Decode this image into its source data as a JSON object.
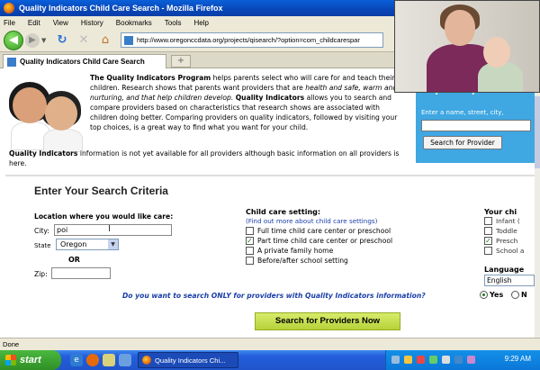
{
  "window": {
    "title": "Quality Indicators Child Care Search - Mozilla Firefox"
  },
  "menu": [
    "File",
    "Edit",
    "View",
    "History",
    "Bookmarks",
    "Tools",
    "Help"
  ],
  "nav": {
    "url": "http://www.oregonccdata.org/projects/qisearch/?option=com_childcarespar"
  },
  "tabs": [
    {
      "label": "Quality Indicators Child Care Search"
    }
  ],
  "page": {
    "intro_program": "The Quality Indicators Program",
    "intro_1": " helps parents select who will care for and teach their children. Research shows that parents want providers that are ",
    "intro_italic": "health and safe, warm and nurturing, and that help children develop.",
    "intro_qi": "Quality Indicators",
    "intro_2": " allows you to search and compare providers based on characteristics that research shows are associated with children doing better. Comparing providers on quality indicators, followed by visiting your top choices, is a great way to find what you want for your child.",
    "note_bold": "Quality Indicators",
    "note_rest": " information is not yet available for all providers although basic information on all providers is here.",
    "side": {
      "heading": "a specific provider",
      "label": "Enter a name, street, city,",
      "button": "Search for Provider"
    },
    "criteria": {
      "title": "Enter Your Search Criteria",
      "location_label": "Location where you would like care:",
      "city_label": "City:",
      "city_value": "poi",
      "state_label": "State",
      "state_value": "Oregon",
      "or_label": "OR",
      "zip_label": "Zip:",
      "setting_label": "Child care setting:",
      "setting_link": "(Find out more about child care settings)",
      "settings": [
        {
          "label": "Full time child care center or preschool",
          "checked": false
        },
        {
          "label": "Part time child care center or preschool",
          "checked": true
        },
        {
          "label": "A private family home",
          "checked": false
        },
        {
          "label": "Before/after school setting",
          "checked": false
        }
      ],
      "your_child_label": "Your chi",
      "ages": [
        {
          "label": "Infant (",
          "checked": false
        },
        {
          "label": "Toddle",
          "checked": false
        },
        {
          "label": "Presch",
          "checked": true
        },
        {
          "label": "School a",
          "checked": false
        }
      ],
      "language_label": "Language",
      "language_value": "English",
      "qi_question": "Do you want to search ONLY for providers with Quality Indicators information?",
      "yes_label": "Yes",
      "no_label": "N",
      "search_button": "Search for Providers Now"
    }
  },
  "status": "Done",
  "taskbar": {
    "start": "start",
    "task": "Quality Indicators Chi...",
    "clock": "9:29 AM"
  }
}
